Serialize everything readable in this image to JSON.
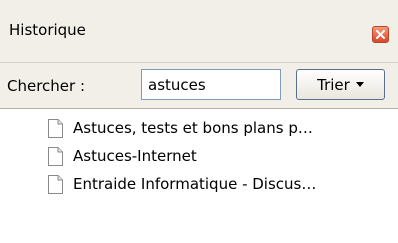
{
  "panel": {
    "title": "Historique",
    "close_icon": "close-icon"
  },
  "search": {
    "label": "Chercher :",
    "value": "astuces",
    "sort_label": "Trier",
    "sort_icon": "chevron-down-icon"
  },
  "history": {
    "items": [
      {
        "label": "Astuces, tests et bons plans p…",
        "icon": "page-icon"
      },
      {
        "label": "Astuces-Internet",
        "icon": "page-icon"
      },
      {
        "label": "Entraide Informatique - Discus…",
        "icon": "page-icon"
      }
    ]
  },
  "colors": {
    "panel_bg": "#f2efe9",
    "close_red": "#d9462a",
    "input_border": "#7f9db9"
  }
}
